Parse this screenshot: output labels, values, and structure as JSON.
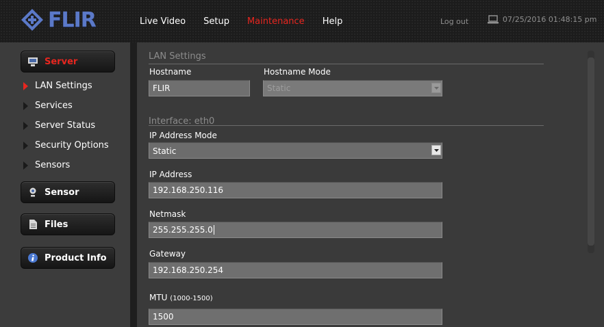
{
  "brand": {
    "logo_text": "FLIR",
    "logo_color": "#5b79c8"
  },
  "nav": {
    "items": [
      {
        "label": "Live Video"
      },
      {
        "label": "Setup"
      },
      {
        "label": "Maintenance",
        "active": true
      },
      {
        "label": "Help"
      }
    ],
    "logout": "Log out",
    "datetime": "07/25/2016 01:48:15 pm",
    "active_color": "#e8261f"
  },
  "sidebar": {
    "server": {
      "label": "Server",
      "icon": "server-icon"
    },
    "items": [
      {
        "label": "LAN Settings",
        "active": true
      },
      {
        "label": "Services"
      },
      {
        "label": "Server Status"
      },
      {
        "label": "Security Options"
      },
      {
        "label": "Sensors"
      }
    ],
    "sensor": {
      "label": "Sensor",
      "icon": "sensor-icon"
    },
    "files": {
      "label": "Files",
      "icon": "file-icon"
    },
    "product_info": {
      "label": "Product Info",
      "icon": "info-icon"
    }
  },
  "lan": {
    "section_title": "LAN Settings",
    "hostname_label": "Hostname",
    "hostname_value": "FLIR",
    "hostname_mode_label": "Hostname Mode",
    "hostname_mode_value": "Static"
  },
  "interface": {
    "section_title": "Interface: eth0",
    "ip_mode_label": "IP Address Mode",
    "ip_mode_value": "Static",
    "ip_label": "IP Address",
    "ip_value": "192.168.250.116",
    "netmask_label": "Netmask",
    "netmask_value": "255.255.255.0",
    "gateway_label": "Gateway",
    "gateway_value": "192.168.250.254",
    "mtu_label": "MTU",
    "mtu_range": "(1000-1500)",
    "mtu_value": "1500"
  }
}
